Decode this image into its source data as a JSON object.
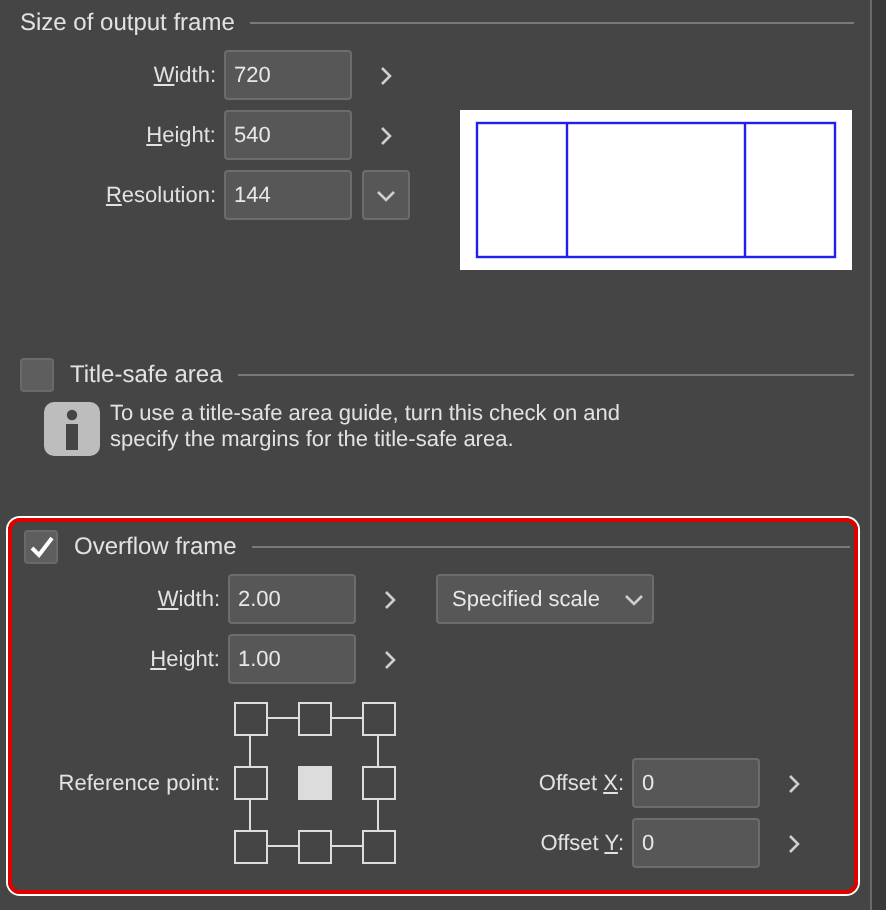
{
  "output_frame": {
    "title": "Size of output frame",
    "fields": [
      {
        "key": "W",
        "label_post": "idth:",
        "value": "720",
        "kind": "arrow"
      },
      {
        "key": "H",
        "label_post": "eight:",
        "value": "540",
        "kind": "arrow"
      },
      {
        "key": "R",
        "label_post": "esolution:",
        "value": "144",
        "kind": "dropdown"
      }
    ]
  },
  "title_safe": {
    "label": "Title-safe area",
    "checked": false,
    "info": "To use a title-safe area guide, turn this check on and\nspecify the margins for the title-safe area."
  },
  "overflow_frame": {
    "label": "Overflow frame",
    "checked": true,
    "fields": [
      {
        "key": "W",
        "label_post": "idth:",
        "value": "2.00",
        "kind": "arrow"
      },
      {
        "key": "H",
        "label_post": "eight:",
        "value": "1.00",
        "kind": "arrow"
      }
    ],
    "scale_mode": "Specified scale",
    "reference_point": {
      "label": "Reference point:",
      "points": [
        {
          "selected": false
        },
        {
          "selected": false
        },
        {
          "selected": false
        },
        {
          "selected": false
        },
        {
          "selected": true
        },
        {
          "selected": false
        },
        {
          "selected": false
        },
        {
          "selected": false
        },
        {
          "selected": false
        }
      ]
    },
    "offsets": [
      {
        "label_pre": "Offset ",
        "key": "X",
        "label_post": ":",
        "value": "0"
      },
      {
        "label_pre": "Offset ",
        "key": "Y",
        "label_post": ":",
        "value": "0"
      }
    ]
  }
}
